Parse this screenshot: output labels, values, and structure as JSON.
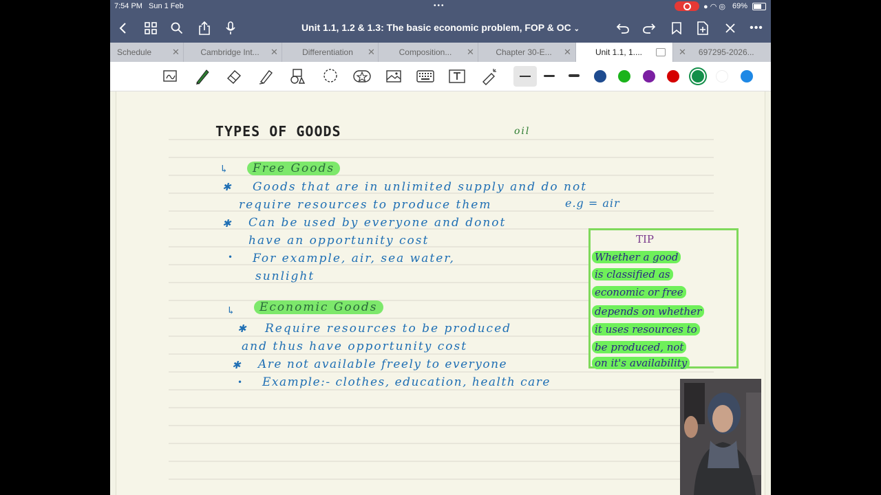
{
  "status": {
    "time": "7:54 PM",
    "date": "Sun 1 Feb",
    "battery": "69%"
  },
  "doc": {
    "title": "Unit 1.1, 1.2 & 1.3: The basic economic problem, FOP & OC"
  },
  "tabs": [
    {
      "label": "Schedule",
      "active": false
    },
    {
      "label": "Cambridge Int...",
      "active": false
    },
    {
      "label": "Differentiation",
      "active": false
    },
    {
      "label": "Composition...",
      "active": false
    },
    {
      "label": "Chapter 30-E...",
      "active": false
    },
    {
      "label": "Unit 1.1, 1....",
      "active": true
    },
    {
      "label": "697295-2026...",
      "active": false
    }
  ],
  "toolbar": {
    "colors": [
      "#1e4b8f",
      "#1bb31b",
      "#7b1fa2",
      "#d50000",
      "#148f4a",
      "#ffffff",
      "#1e88e5"
    ]
  },
  "note": {
    "heading": "TYPES OF GOODS",
    "margin_word": "oil",
    "free_goods_label": "Free Goods",
    "free_line1": "Goods that are in unlimited supply and do not",
    "free_line2": "require resources to produce them",
    "free_eg": "e.g = air",
    "free_line3": "Can be used by everyone and donot",
    "free_line4": "have an opportunity cost",
    "free_line5": "For example, air, sea water,",
    "free_line6": "sunlight",
    "econ_goods_label": "Economic Goods",
    "econ_line1": "Require resources to be produced",
    "econ_line2": "and thus have opportunity cost",
    "econ_line3": "Are not available freely to everyone",
    "econ_line4": "Example:- clothes, education, health care"
  },
  "tip": {
    "title": "TIP",
    "lines": [
      "Whether a good",
      "is classified as",
      "economic or free",
      "depends on whether",
      "it uses resources to",
      "be produced, not",
      "on it's availability"
    ]
  }
}
